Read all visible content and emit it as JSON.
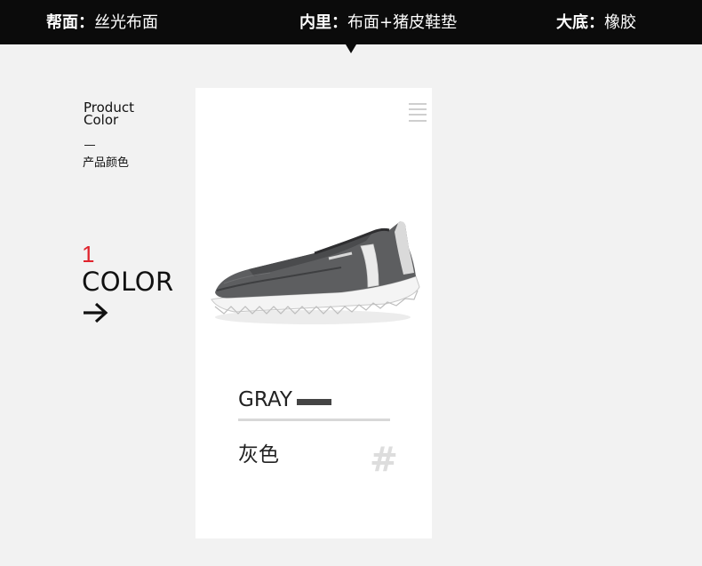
{
  "specs": [
    {
      "key": "帮面：",
      "value": "丝光布面"
    },
    {
      "key": "内里：",
      "value": "布面+猪皮鞋垫"
    },
    {
      "key": "大底：",
      "value": "橡胶"
    }
  ],
  "section": {
    "title_en_line1": "Product",
    "title_en_line2": "Color",
    "title_zh": "产品颜色"
  },
  "color_count": {
    "number": "1",
    "label": "COLOR",
    "number_color": "#e0232d"
  },
  "product": {
    "color_name_en": "GRAY",
    "color_name_zh": "灰色",
    "swatch_color": "#444444",
    "hash_mark": "#"
  },
  "icons": {
    "arrow": "arrow-right-icon",
    "menu": "menu-lines-icon"
  }
}
